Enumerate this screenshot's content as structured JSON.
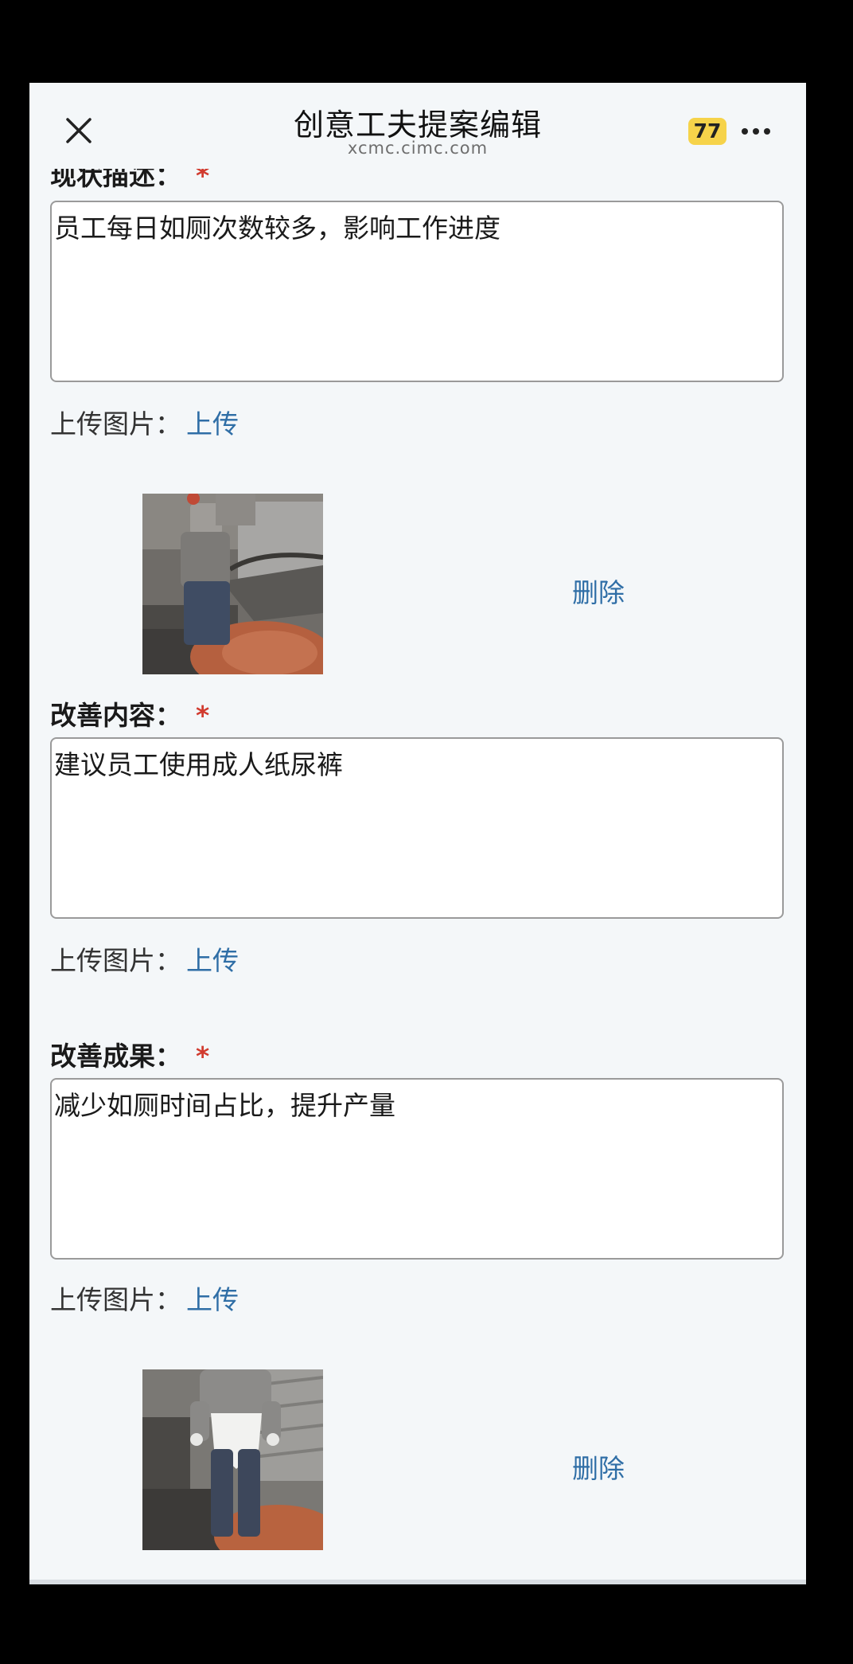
{
  "header": {
    "title": "创意工夫提案编辑",
    "url": "xcmc.cimc.com",
    "badge_count": "77",
    "close_icon": "close-icon",
    "more_icon": "more-dots-icon"
  },
  "sections": [
    {
      "label": "现状描述：",
      "required": "*",
      "text": "员工每日如厕次数较多，影响工作进度",
      "upload_label": "上传图片：",
      "upload_link": "上传",
      "delete_label": "删除",
      "image": "photo-worker-at-machine"
    },
    {
      "label": "改善内容：",
      "required": "*",
      "text": "建议员工使用成人纸尿裤",
      "upload_label": "上传图片：",
      "upload_link": "上传"
    },
    {
      "label": "改善成果：",
      "required": "*",
      "text": "减少如厕时间占比，提升产量",
      "upload_label": "上传图片：",
      "upload_link": "上传",
      "delete_label": "删除",
      "image": "photo-worker-wearing-diaper"
    }
  ],
  "colors": {
    "background": "#f4f7f9",
    "link": "#2f6ea6",
    "required": "#d13b2f",
    "badge": "#f6d34a"
  }
}
